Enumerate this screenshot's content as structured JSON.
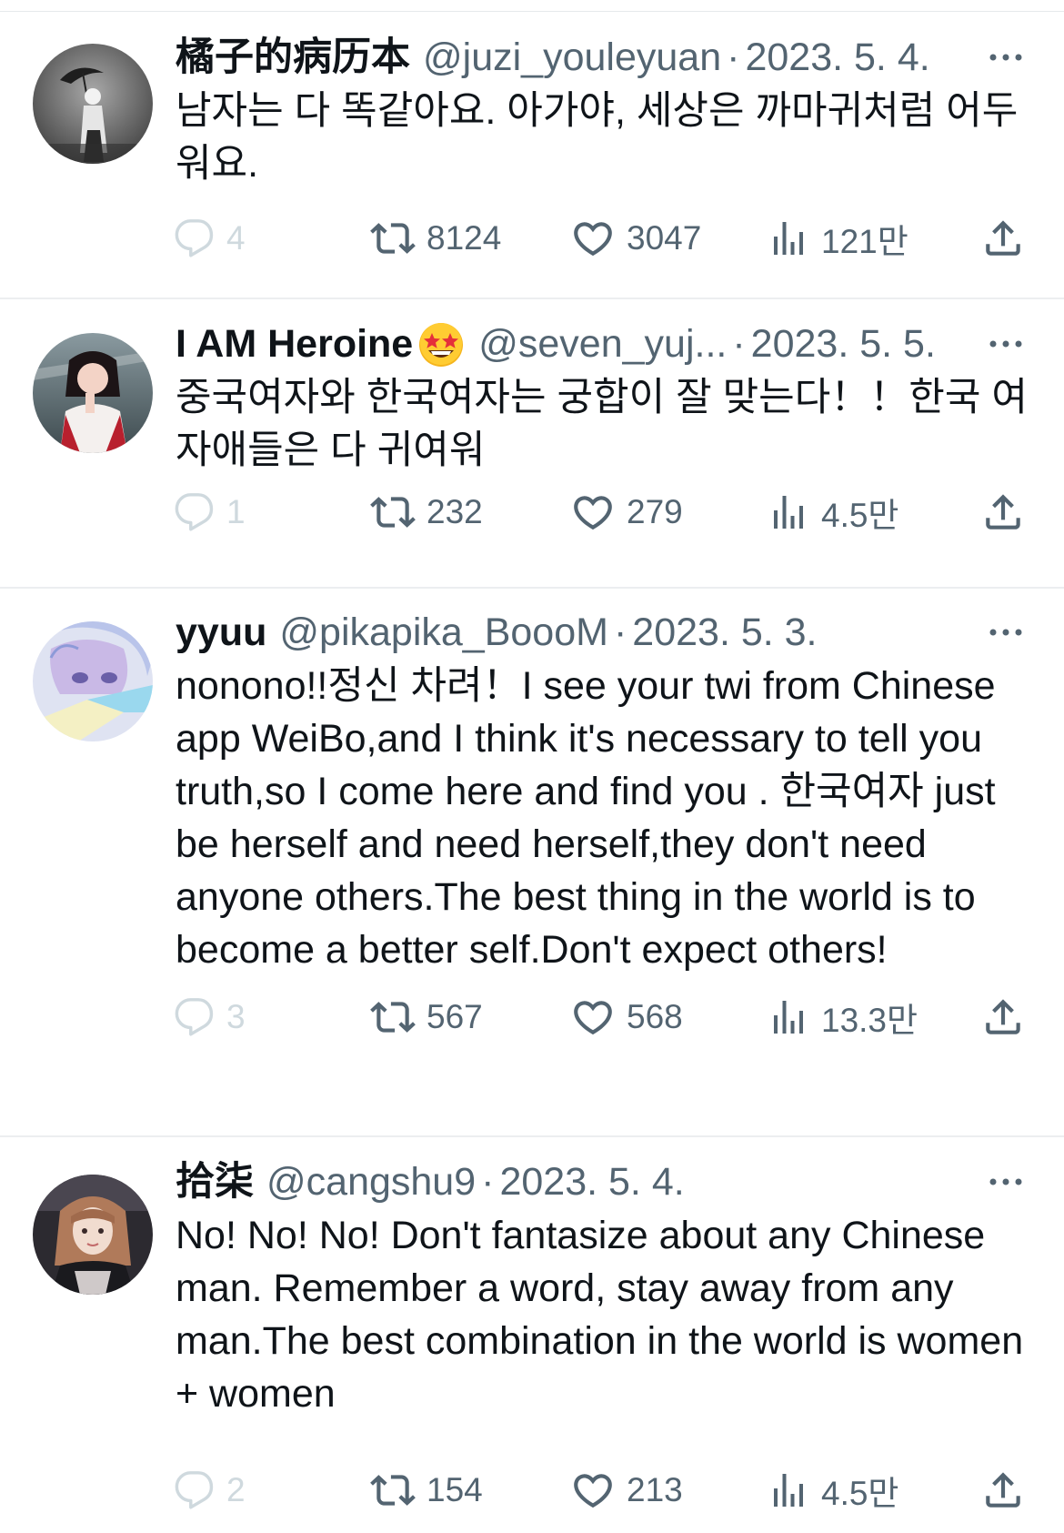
{
  "tweets": [
    {
      "name": "橘子的病历本",
      "handle": "@juzi_youleyuan",
      "separator": "·",
      "date": "2023. 5. 4.",
      "text": "남자는 다 똑같아요. 아가야, 세상은 까마귀처럼 어두워요.",
      "replies": "4",
      "retweets": "8124",
      "likes": "3047",
      "views": "121만",
      "avatar_icon": "avatar-umbrella-person-bw"
    },
    {
      "name": "I AM Heroine",
      "name_emoji": "star-struck-emoji",
      "handle": "@seven_yuj...",
      "separator": "·",
      "date": "2023. 5. 5.",
      "text": "중국여자와 한국여자는 궁합이 잘 맞는다！！한국 여자애들은 다 귀여워",
      "replies": "1",
      "retweets": "232",
      "likes": "279",
      "views": "4.5만",
      "avatar_icon": "avatar-singer-photo"
    },
    {
      "name": "yyuu",
      "handle": "@pikapika_BoooM",
      "separator": "·",
      "date": "2023. 5. 3.",
      "text": "nonono!!정신 차려！I see your twi from Chinese app WeiBo,and I think it's necessary to tell you truth,so I come here and find you . 한국여자 just be herself and need herself,they don't need anyone others.The best thing in the world is to become a better self.Don't expect others!",
      "replies": "3",
      "retweets": "567",
      "likes": "568",
      "views": "13.3만",
      "avatar_icon": "avatar-anime-illustration"
    },
    {
      "name": "拾柒",
      "handle": "@cangshu9",
      "separator": "·",
      "date": "2023. 5. 4.",
      "text": "No! No! No! Don't fantasize about any Chinese man. Remember a word, stay away from any man.The best combination in the world is women + women",
      "replies": "2",
      "retweets": "154",
      "likes": "213",
      "views": "4.5만",
      "avatar_icon": "avatar-selfie-photo"
    }
  ],
  "colors": {
    "text": "#0f1419",
    "secondary": "#536471",
    "muted": "#cfd9de",
    "divider": "#eceef0"
  }
}
